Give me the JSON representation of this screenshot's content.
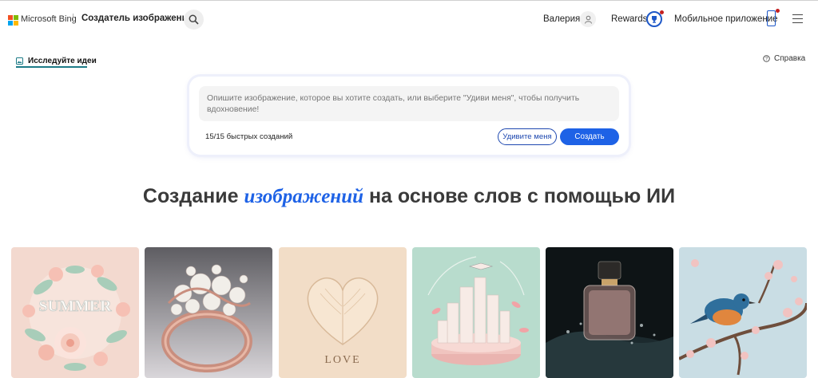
{
  "header": {
    "brand": "Microsoft Bing",
    "separator": "|",
    "app_title": "Создатель изображений",
    "user_name": "Валерия",
    "rewards_label": "Rewards",
    "mobile_label": "Мобильное приложение"
  },
  "tabs": {
    "explore_label": "Исследуйте идеи",
    "help_label": "Справка"
  },
  "prompt": {
    "placeholder": "Опишите изображение, которое вы хотите создать, или выберите \"Удиви меня\", чтобы получить вдохновение!",
    "boosts_text": "15/15 быстрых созданий",
    "surprise_label": "Удивите меня",
    "create_label": "Создать"
  },
  "headline": {
    "before": "Создание ",
    "accent": "изображений",
    "after": " на основе слов с помощью ИИ"
  },
  "gallery": {
    "tiles": [
      {
        "name": "summer-wreath",
        "caption": "SUMMER"
      },
      {
        "name": "pearl-ring",
        "caption": ""
      },
      {
        "name": "paper-heart",
        "caption": "LOVE"
      },
      {
        "name": "paper-city",
        "caption": ""
      },
      {
        "name": "perfume-bottle",
        "caption": ""
      },
      {
        "name": "bird-on-branch",
        "caption": ""
      }
    ]
  },
  "colors": {
    "accent_blue": "#1e62e6",
    "tab_underline": "#1d7b87",
    "notification_red": "#c42020"
  }
}
